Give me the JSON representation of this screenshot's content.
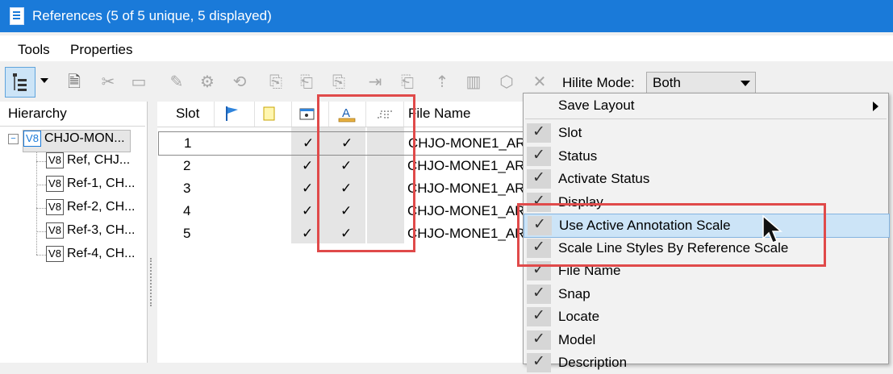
{
  "window": {
    "title": "References (5 of 5 unique, 5 displayed)"
  },
  "menubar": {
    "tools": "Tools",
    "properties": "Properties"
  },
  "toolbar": {
    "hilite_label": "Hilite Mode:",
    "hilite_value": "Both"
  },
  "hierarchy": {
    "header": "Hierarchy",
    "root": {
      "badge": "V8",
      "label": "CHJO-MON..."
    },
    "children": [
      {
        "badge": "V8",
        "label": "Ref, CHJ..."
      },
      {
        "badge": "V8",
        "label": "Ref-1, CH..."
      },
      {
        "badge": "V8",
        "label": "Ref-2, CH..."
      },
      {
        "badge": "V8",
        "label": "Ref-3, CH..."
      },
      {
        "badge": "V8",
        "label": "Ref-4, CH..."
      }
    ]
  },
  "grid": {
    "columns": {
      "slot": "Slot",
      "file_name": "File Name"
    },
    "rows": [
      {
        "slot": "1",
        "display": "✓",
        "annotation": "✓",
        "file": "CHJO-MONE1_AR"
      },
      {
        "slot": "2",
        "display": "✓",
        "annotation": "✓",
        "file": "CHJO-MONE1_AR"
      },
      {
        "slot": "3",
        "display": "✓",
        "annotation": "✓",
        "file": "CHJO-MONE1_AR"
      },
      {
        "slot": "4",
        "display": "✓",
        "annotation": "✓",
        "file": "CHJO-MONE1_AR"
      },
      {
        "slot": "5",
        "display": "✓",
        "annotation": "✓",
        "file": "CHJO-MONE1_AR"
      }
    ]
  },
  "context_menu": {
    "save_layout": "Save Layout",
    "items": [
      {
        "label": "Slot",
        "checked": true
      },
      {
        "label": "Status",
        "checked": true
      },
      {
        "label": "Activate Status",
        "checked": true
      },
      {
        "label": "Display",
        "checked": true
      },
      {
        "label": "Use Active Annotation Scale",
        "checked": true
      },
      {
        "label": "Scale Line Styles By Reference Scale",
        "checked": true
      },
      {
        "label": "File Name",
        "checked": true
      },
      {
        "label": "Snap",
        "checked": true
      },
      {
        "label": "Locate",
        "checked": true
      },
      {
        "label": "Model",
        "checked": true
      },
      {
        "label": "Description",
        "checked": true
      }
    ]
  },
  "colors": {
    "titlebar": "#1a7ad9",
    "highlight_box": "#e04a4a",
    "menu_highlight": "#cce4f7"
  }
}
